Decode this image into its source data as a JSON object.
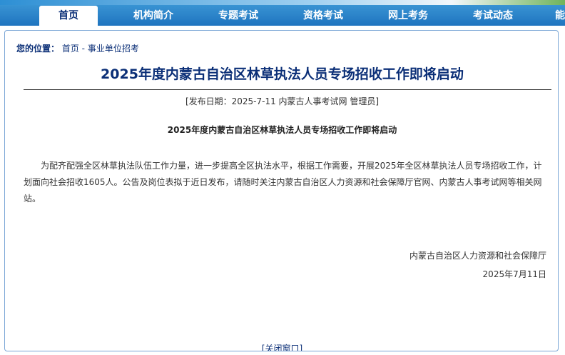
{
  "nav": {
    "items": [
      {
        "label": "首页",
        "active": true
      },
      {
        "label": "机构简介",
        "active": false
      },
      {
        "label": "专题考试",
        "active": false
      },
      {
        "label": "资格考试",
        "active": false
      },
      {
        "label": "网上考务",
        "active": false
      },
      {
        "label": "考试动态",
        "active": false
      },
      {
        "label": "能",
        "active": false
      }
    ]
  },
  "breadcrumb": {
    "prefix": "您的位置：",
    "home": "首页",
    "separator": " - ",
    "current": "事业单位招考"
  },
  "article": {
    "title": "2025年度内蒙古自治区林草执法人员专场招收工作即将启动",
    "pub_info": "[发布日期：2025-7-11 内蒙古人事考试网 管理员]",
    "subtitle": "2025年度内蒙古自治区林草执法人员专场招收工作即将启动",
    "body": "为配齐配强全区林草执法队伍工作力量，进一步提高全区执法水平，根据工作需要，开展2025年全区林草执法人员专场招收工作，计划面向社会招收1605人。公告及岗位表拟于近日发布，请随时关注内蒙古自治区人力资源和社会保障厅官网、内蒙古人事考试网等相关网站。",
    "sign_org": "内蒙古自治区人力资源和社会保障厅",
    "sign_date": "2025年7月11日"
  },
  "footer": {
    "close_link": "[关闭窗口]"
  },
  "colors": {
    "nav_bar": "#2a86cd",
    "title_text": "#0b2f77",
    "box_border": "#7aa6d6"
  }
}
